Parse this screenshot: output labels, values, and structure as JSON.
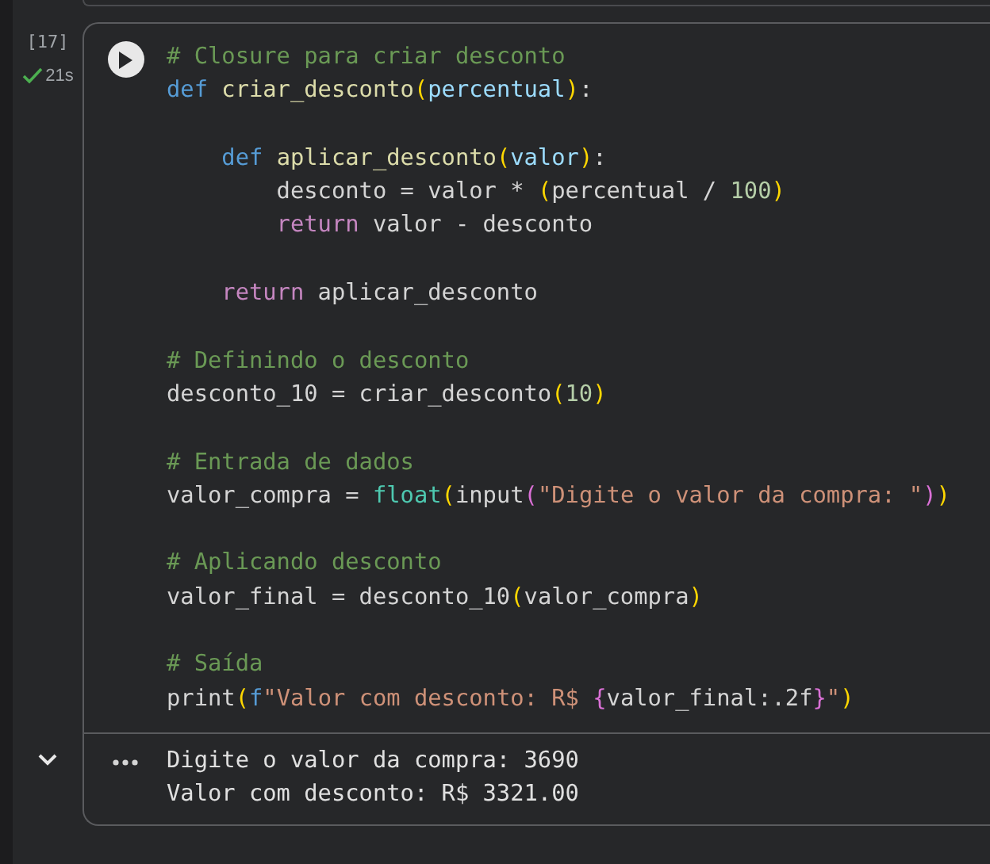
{
  "cell": {
    "execution_count": "[17]",
    "status": {
      "done": true,
      "duration": "21s"
    },
    "code": [
      {
        "tokens": [
          {
            "kind": "comment",
            "t": "# Closure para criar desconto"
          }
        ]
      },
      {
        "tokens": [
          {
            "kind": "keyword",
            "t": "def "
          },
          {
            "kind": "func",
            "t": "criar_desconto"
          },
          {
            "kind": "paren1",
            "t": "("
          },
          {
            "kind": "param",
            "t": "percentual"
          },
          {
            "kind": "paren1",
            "t": ")"
          },
          {
            "kind": "plain",
            "t": ":"
          }
        ]
      },
      {
        "kind": "blank"
      },
      {
        "tokens": [
          {
            "kind": "keyword",
            "t": "    def "
          },
          {
            "kind": "func",
            "t": "aplicar_desconto"
          },
          {
            "kind": "paren1",
            "t": "("
          },
          {
            "kind": "param",
            "t": "valor"
          },
          {
            "kind": "paren1",
            "t": ")"
          },
          {
            "kind": "plain",
            "t": ":"
          }
        ]
      },
      {
        "tokens": [
          {
            "kind": "plain",
            "t": "        desconto = valor * "
          },
          {
            "kind": "paren1",
            "t": "("
          },
          {
            "kind": "plain",
            "t": "percentual / "
          },
          {
            "kind": "number",
            "t": "100"
          },
          {
            "kind": "paren1",
            "t": ")"
          }
        ]
      },
      {
        "tokens": [
          {
            "kind": "control",
            "t": "        return"
          },
          {
            "kind": "plain",
            "t": " valor - desconto"
          }
        ]
      },
      {
        "kind": "blank"
      },
      {
        "tokens": [
          {
            "kind": "control",
            "t": "    return"
          },
          {
            "kind": "plain",
            "t": " aplicar_desconto"
          }
        ]
      },
      {
        "kind": "blank"
      },
      {
        "tokens": [
          {
            "kind": "comment",
            "t": "# Definindo o desconto"
          }
        ]
      },
      {
        "tokens": [
          {
            "kind": "plain",
            "t": "desconto_10 = criar_desconto"
          },
          {
            "kind": "paren1",
            "t": "("
          },
          {
            "kind": "number",
            "t": "10"
          },
          {
            "kind": "paren1",
            "t": ")"
          }
        ]
      },
      {
        "kind": "blank"
      },
      {
        "tokens": [
          {
            "kind": "comment",
            "t": "# Entrada de dados"
          }
        ]
      },
      {
        "tokens": [
          {
            "kind": "plain",
            "t": "valor_compra = "
          },
          {
            "kind": "builtin",
            "t": "float"
          },
          {
            "kind": "paren1",
            "t": "("
          },
          {
            "kind": "plain",
            "t": "input"
          },
          {
            "kind": "paren2",
            "t": "("
          },
          {
            "kind": "string",
            "t": "\"Digite o valor da compra: \""
          },
          {
            "kind": "paren2",
            "t": ")"
          },
          {
            "kind": "paren1",
            "t": ")"
          }
        ]
      },
      {
        "kind": "blank"
      },
      {
        "tokens": [
          {
            "kind": "comment",
            "t": "# Aplicando desconto"
          }
        ]
      },
      {
        "tokens": [
          {
            "kind": "plain",
            "t": "valor_final = desconto_10"
          },
          {
            "kind": "paren1",
            "t": "("
          },
          {
            "kind": "plain",
            "t": "valor_compra"
          },
          {
            "kind": "paren1",
            "t": ")"
          }
        ]
      },
      {
        "kind": "blank"
      },
      {
        "tokens": [
          {
            "kind": "comment",
            "t": "# Saída"
          }
        ]
      },
      {
        "tokens": [
          {
            "kind": "plain",
            "t": "print"
          },
          {
            "kind": "paren1",
            "t": "("
          },
          {
            "kind": "keyword",
            "t": "f"
          },
          {
            "kind": "string",
            "t": "\"Valor com desconto: R$ "
          },
          {
            "kind": "paren2",
            "t": "{"
          },
          {
            "kind": "plain",
            "t": "valor_final:.2f"
          },
          {
            "kind": "paren2",
            "t": "}"
          },
          {
            "kind": "string",
            "t": "\""
          },
          {
            "kind": "paren1",
            "t": ")"
          }
        ]
      }
    ],
    "output": {
      "expanded": true,
      "lines": [
        "Digite o valor da compra: 3690",
        "Valor com desconto: R$ 3321.00"
      ]
    }
  }
}
